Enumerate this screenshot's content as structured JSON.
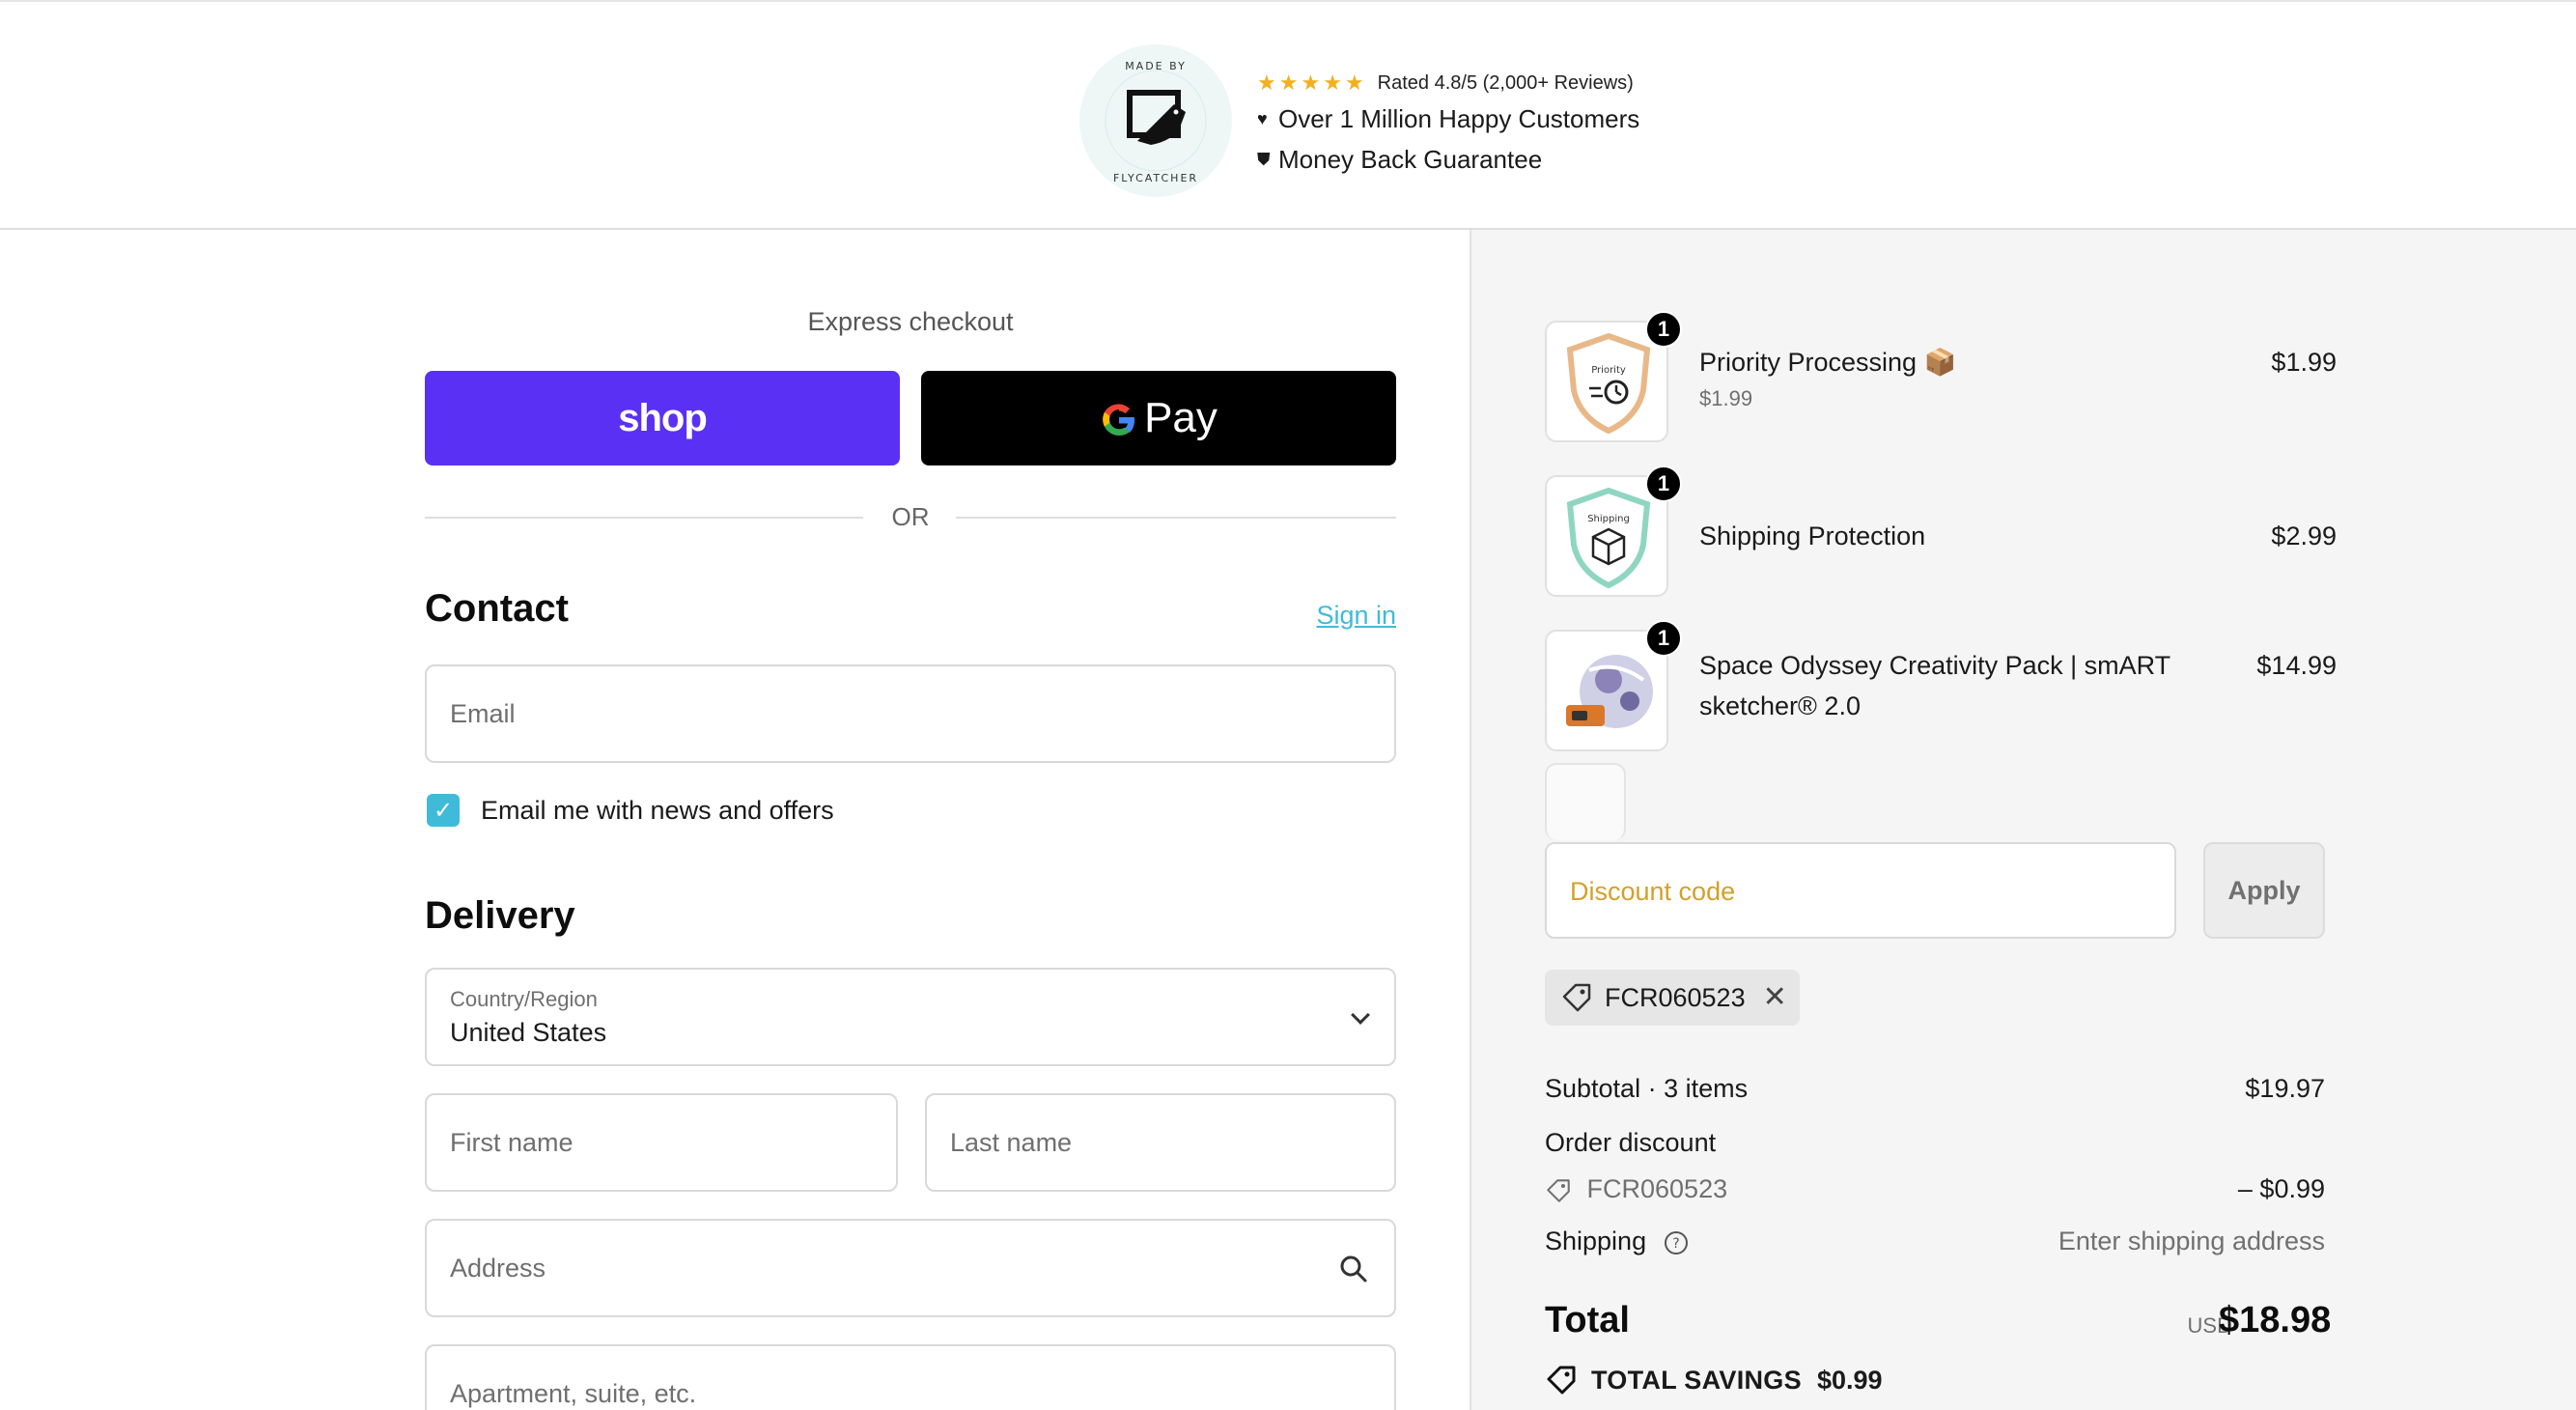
{
  "header": {
    "rating_text": "Rated 4.8/5 (2,000+ Reviews)",
    "stars": 5,
    "line1": "Over 1 Million Happy Customers",
    "line2": "Money Back Guarantee",
    "logo_text": "MADE BY FLYCATCHER"
  },
  "express": {
    "label": "Express checkout",
    "shop_label": "shop",
    "gpay_label": "Pay",
    "gpay_g": "G",
    "or_label": "OR"
  },
  "contact": {
    "title": "Contact",
    "signin_label": "Sign in",
    "email_placeholder": "Email",
    "newsletter_label": "Email me with news and offers",
    "newsletter_checked": true
  },
  "delivery": {
    "title": "Delivery",
    "country_label": "Country/Region",
    "country_value": "United States",
    "first_name_placeholder": "First name",
    "last_name_placeholder": "Last name",
    "address_placeholder": "Address",
    "apartment_placeholder": "Apartment, suite, etc."
  },
  "summary": {
    "items": [
      {
        "qty": "1",
        "name": "Priority Processing 📦",
        "sub": "$1.99",
        "price": "$1.99",
        "thumb_label": "Priority"
      },
      {
        "qty": "1",
        "name": "Shipping Protection",
        "sub": "",
        "price": "$2.99",
        "thumb_label": "Shipping"
      },
      {
        "qty": "1",
        "name": "Space Odyssey Creativity Pack | smART",
        "name2": "sketcher® 2.0",
        "sub": "",
        "price": "$14.99",
        "thumb_label": ""
      }
    ],
    "discount_placeholder": "Discount code",
    "apply_label": "Apply",
    "applied_code": "FCR060523",
    "subtotal_label": "Subtotal · 3 items",
    "subtotal_value": "$19.97",
    "order_discount_label": "Order discount",
    "order_discount_code": "FCR060523",
    "order_discount_value": "– $0.99",
    "shipping_label": "Shipping",
    "shipping_value": "Enter shipping address",
    "total_label": "Total",
    "total_currency": "USD",
    "total_value": "$18.98",
    "savings_label": "TOTAL SAVINGS",
    "savings_value": "$0.99"
  },
  "colors": {
    "shop_purple": "#5a31f4",
    "accent_cyan": "#3fbbd9",
    "discount_gold": "#d4a02a",
    "star_yellow": "#f2b01e"
  }
}
